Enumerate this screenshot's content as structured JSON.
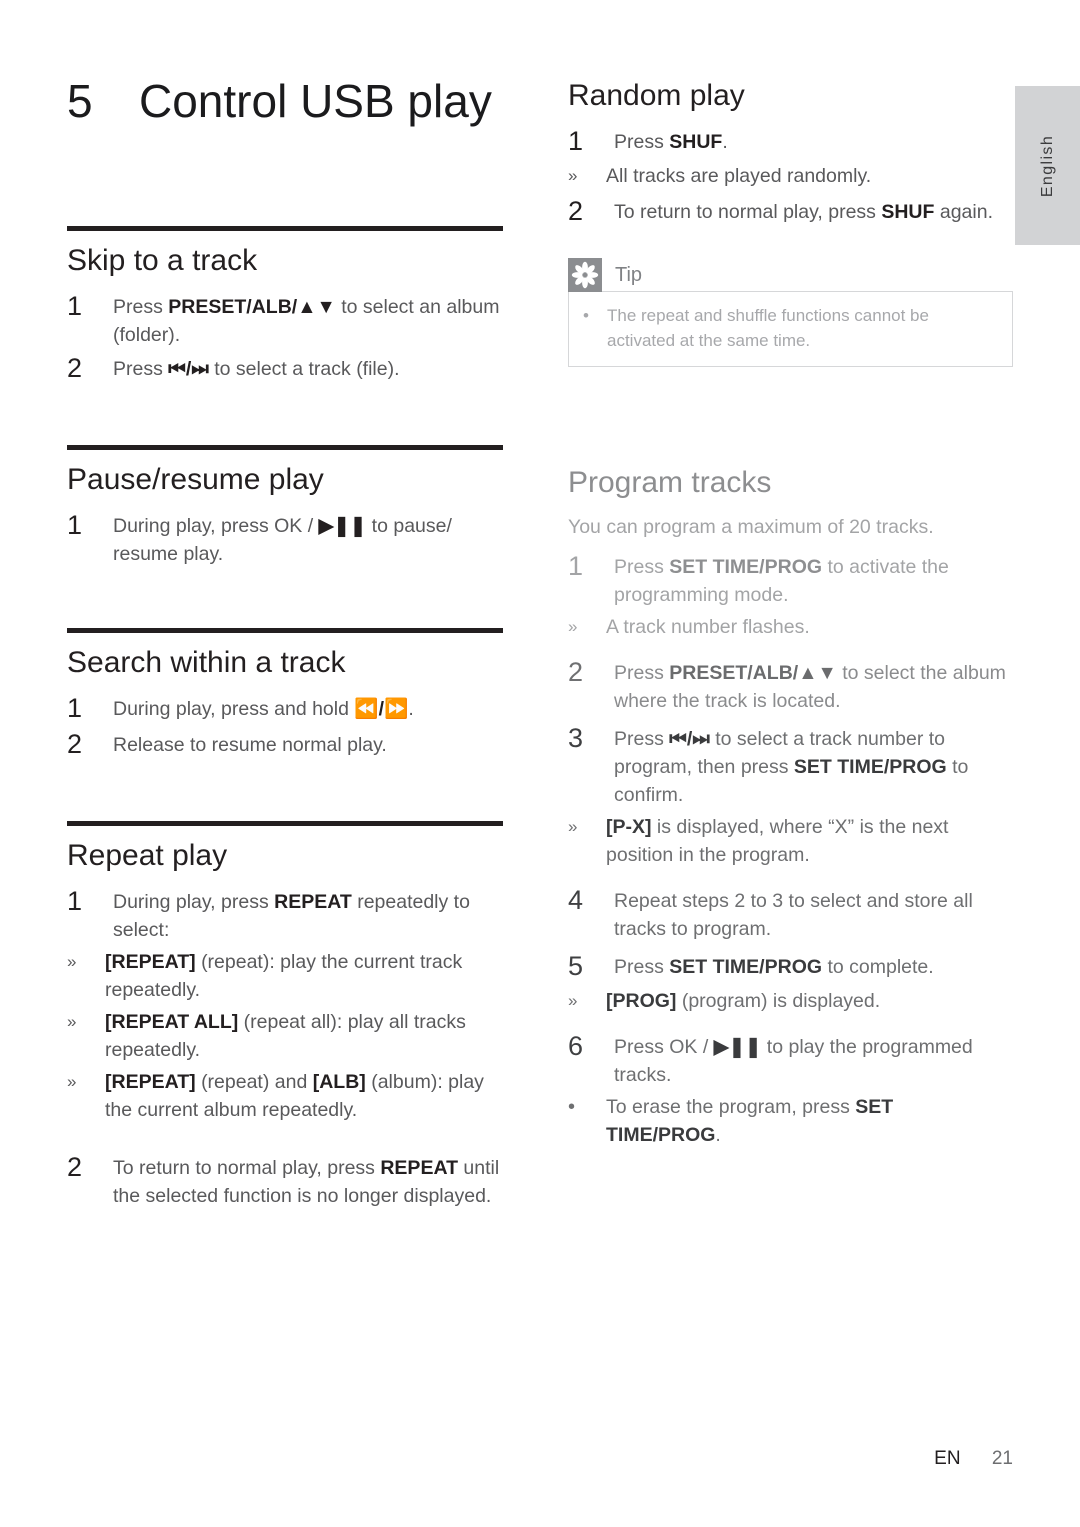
{
  "lang_tab": {
    "label": "English"
  },
  "chapter": {
    "number": "5",
    "title": "Control USB play"
  },
  "footer": {
    "locale": "EN",
    "page": "21"
  },
  "left_column": {
    "sections": [
      {
        "heading": "Skip to a track",
        "steps": [
          {
            "num": "1",
            "text": "Press PRESET/ALB/▲▼ to select an album (folder)."
          },
          {
            "num": "2",
            "text": "Press ⏮/⏭ to select a track (file)."
          }
        ]
      },
      {
        "heading": "Pause/resume play",
        "steps": [
          {
            "num": "1",
            "text": "During play, press OK / ▶❙❙ to pause/ resume play."
          }
        ]
      },
      {
        "heading": "Search within a track",
        "steps": [
          {
            "num": "1",
            "text": "During play, press and hold ⏪/⏩."
          },
          {
            "num": "2",
            "text": "Release to resume normal play."
          }
        ]
      },
      {
        "heading": "Repeat play",
        "steps": [
          {
            "num": "1",
            "text": "During play, press REPEAT repeatedly to select:"
          },
          {
            "num": "2",
            "text": "To return to normal play, press REPEAT until the selected function is no longer displayed."
          }
        ],
        "bullets": [
          {
            "mark": "»",
            "label": "[REPEAT]",
            "text": "(repeat): play the current track repeatedly."
          },
          {
            "mark": "»",
            "label": "[REPEAT ALL]",
            "text": "(repeat all): play all tracks repeatedly."
          },
          {
            "mark": "»",
            "label_a": "[REPEAT]",
            "mid": "(repeat) and",
            "label_b": "[ALB]",
            "text": "(album): play the current album repeatedly."
          }
        ]
      }
    ]
  },
  "right_column": {
    "random_play": {
      "heading": "Random play",
      "steps": [
        {
          "num": "1",
          "text": "Press SHUF."
        },
        {
          "num": "2",
          "text": "To return to normal play, press SHUF again."
        }
      ],
      "bullets": [
        {
          "mark": "»",
          "text": "All tracks are played randomly."
        }
      ]
    },
    "tip": {
      "icon": "asterisk-flower-icon",
      "label": "Tip",
      "bullet": "•",
      "text": "The repeat and shuffle functions cannot be activated at the same time."
    },
    "program_tracks": {
      "heading": "Program tracks",
      "intro": "You can program a maximum of 20 tracks.",
      "steps": [
        {
          "num": "1",
          "text": "Press SET TIME/PROG to activate the programming mode."
        },
        {
          "num": "2",
          "text": "Press PRESET/ALB/▲▼ to select the album where the track is located."
        },
        {
          "num": "3",
          "text": "Press ⏮/⏭ to select a track number to program, then press SET TIME/PROG to confirm."
        },
        {
          "num": "4",
          "text": "Repeat steps 2 to 3 to select and store all tracks to program."
        },
        {
          "num": "5",
          "text": "Press SET TIME/PROG to complete."
        },
        {
          "num": "6",
          "text": "Press OK / ▶❙❙ to play the programmed tracks."
        }
      ],
      "bullets": {
        "after_1": {
          "mark": "»",
          "text": "A track number flashes."
        },
        "after_3": {
          "mark": "»",
          "label": "[P-X]",
          "text": "is displayed, where “X” is the next position in the program."
        },
        "after_5": {
          "mark": "»",
          "label": "[PROG]",
          "text": "(program) is displayed."
        },
        "after_6": {
          "mark": "•",
          "text": "To erase the program, press SET TIME/PROG."
        }
      }
    }
  },
  "bold_tokens": {
    "preset_alb": "PRESET/ALB/",
    "repeat": "REPEAT",
    "shuf": "SHUF",
    "set_time_prog": "SET TIME/PROG",
    "repeat_br": "[REPEAT]",
    "repeat_all_br": "[REPEAT ALL]",
    "alb_br": "[ALB]",
    "p_x": "[P-X]",
    "prog_br": "[PROG]",
    "set": "SET",
    "time_prog": "TIME/PROG"
  }
}
